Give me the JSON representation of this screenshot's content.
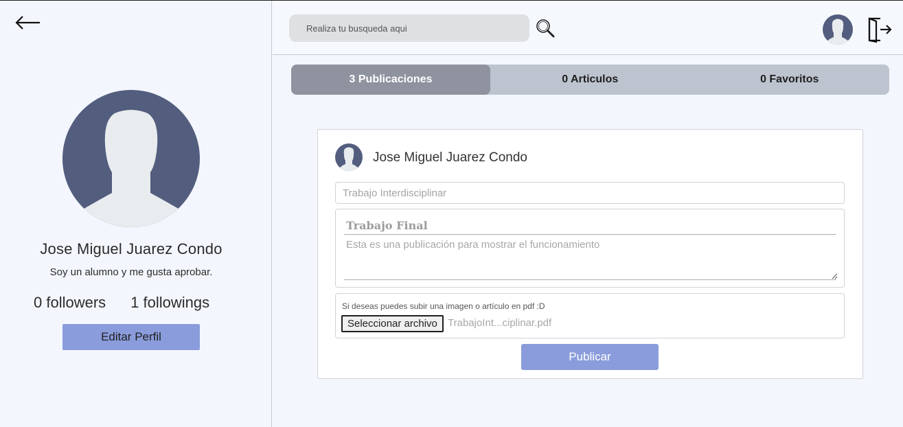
{
  "profile": {
    "name": "Jose Miguel Juarez Condo",
    "bio": "Soy un alumno y me gusta aprobar.",
    "followers": "0 followers",
    "followings": "1 followings",
    "edit_label": "Editar Perfil"
  },
  "search": {
    "placeholder": "Realiza tu busqueda aqui"
  },
  "tabs": [
    {
      "label": "3 Publicaciones",
      "active": true
    },
    {
      "label": "0 Articulos",
      "active": false
    },
    {
      "label": "0 Favoritos",
      "active": false
    }
  ],
  "post_form": {
    "author": "Jose Miguel Juarez Condo",
    "title_placeholder": "Trabajo Interdisciplinar",
    "body_heading": "Trabajo Final",
    "body_text": "Esta es una publicación para mostrar el funcionamiento",
    "upload_hint": "Si deseas puedes subir una imagen o artículo en pdf :D",
    "file_button": "Seleccionar archivo",
    "file_name": "TrabajoInt...ciplinar.pdf",
    "publish_label": "Publicar"
  },
  "icons": {
    "back": "arrow-left-icon",
    "search": "magnifier-icon",
    "logout": "logout-icon",
    "avatar": "user-avatar-icon"
  },
  "colors": {
    "accent": "#8a9cdb",
    "avatar_bg": "#535d7e",
    "avatar_fg": "#e8ecef",
    "tab_active": "#8e939f",
    "tab_bg": "#bec4cf"
  }
}
